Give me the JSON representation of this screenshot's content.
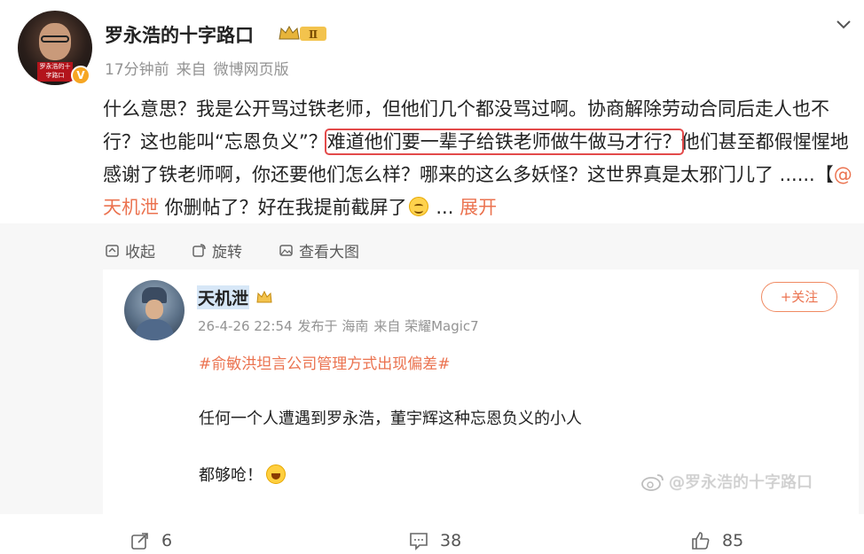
{
  "header": {
    "username": "罗永浩的十字路口",
    "rank_badge": "Ⅱ",
    "time": "17分钟前",
    "source_prefix": "来自",
    "source": "微博网页版",
    "avatar_tag": "罗永浩的十字路口"
  },
  "content": {
    "part1": "什么意思？我是公开骂过铁老师，但他们几个都没骂过啊。协商解除劳动合同后走人也不行？这也能叫“忘恩负义”？",
    "highlight": "难道他们要一辈子给铁老师做牛做马才行？",
    "part2": "他们甚至都假惺惺地感谢了铁老师啊，你还要他们怎么样？哪来的这么多妖怪？这世界真是太邪门儿了 ......【",
    "mention": "@天机泄",
    "part3": " 你删帖了？好在我提前截屏了",
    "ellipsis": " ... ",
    "expand": "展开"
  },
  "media_toolbar": {
    "collapse": "收起",
    "rotate": "旋转",
    "view_large": "查看大图"
  },
  "card": {
    "name": "天机泄",
    "date": "26-4-26 22:54",
    "published_at": "发布于 海南",
    "source": "来自 荣耀Magic7",
    "follow": "+关注",
    "hashtag": "#俞敏洪坦言公司管理方式出现偏差#",
    "line1": "任何一个人遭遇到罗永浩，董宇辉这种忘恩负义的小人",
    "line2": "都够呛！",
    "watermark": "@罗永浩的十字路口"
  },
  "actions": {
    "repost": "6",
    "comment": "38",
    "like": "85"
  },
  "colors": {
    "accent": "#eb7350",
    "highlight_border": "#e34a4a",
    "muted": "#939393"
  }
}
